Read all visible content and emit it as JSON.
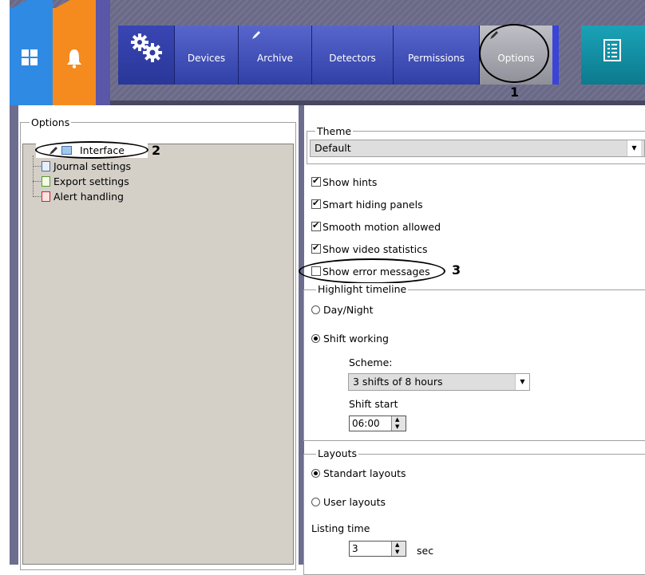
{
  "nav": {
    "devices": "Devices",
    "archive": "Archive",
    "detectors": "Detectors",
    "permissions": "Permissions",
    "options": "Options"
  },
  "left": {
    "group": "Options",
    "tree": [
      "Interface",
      "Journal settings",
      "Export settings",
      "Alert handling"
    ]
  },
  "theme": {
    "legend": "Theme",
    "value": "Default"
  },
  "checkboxes": [
    {
      "label": "Show hints",
      "checked": true
    },
    {
      "label": "Smart hiding panels",
      "checked": true
    },
    {
      "label": "Smooth motion allowed",
      "checked": true
    },
    {
      "label": "Show video statistics",
      "checked": true
    },
    {
      "label": "Show error messages",
      "checked": false
    }
  ],
  "highlight": {
    "legend": "Highlight timeline",
    "day_night": "Day/Night",
    "shift_working": "Shift working",
    "scheme_label": "Scheme:",
    "scheme_value": "3 shifts of 8 hours",
    "shift_start_label": "Shift start",
    "shift_start_value": "06:00"
  },
  "layouts": {
    "legend": "Layouts",
    "standart": "Standart layouts",
    "user": "User layouts",
    "listing_label": "Listing time",
    "listing_value": "3",
    "unit": "sec"
  },
  "callouts": {
    "one": "1",
    "two": "2",
    "three": "3"
  },
  "icons": [
    "windows-icon",
    "bell-icon",
    "gears-icon",
    "pencil-icon",
    "report-icon",
    "dropdown-arrow-icon"
  ]
}
